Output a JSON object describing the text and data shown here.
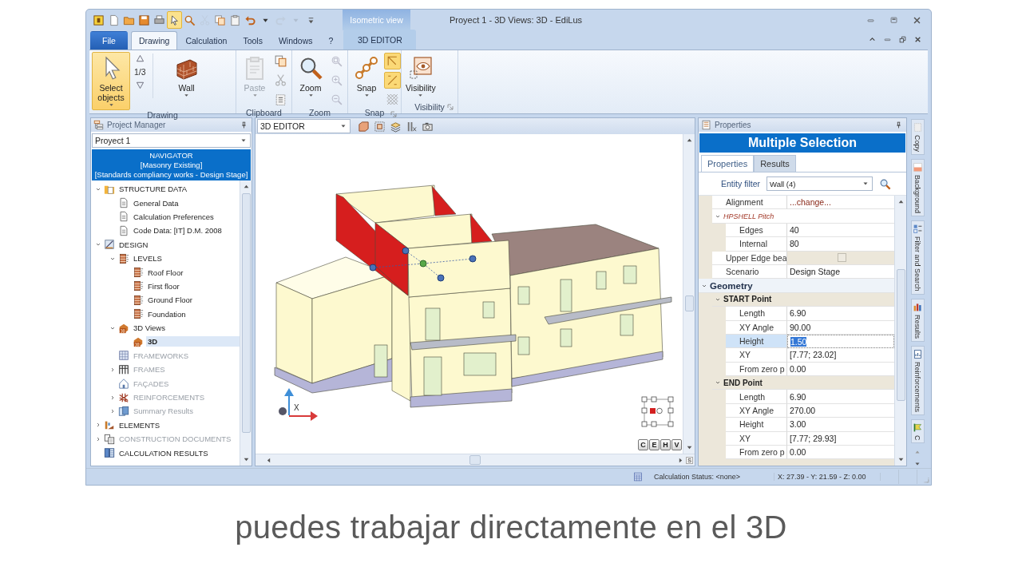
{
  "window": {
    "title": "Proyect 1 - 3D Views: 3D - EdiLus",
    "context_label": "Isometric view"
  },
  "quick_access": [
    {
      "kind": "app",
      "selected": false,
      "disabled": false
    },
    {
      "kind": "new",
      "selected": false,
      "disabled": false
    },
    {
      "kind": "open",
      "selected": false,
      "disabled": false
    },
    {
      "kind": "save",
      "selected": false,
      "disabled": false
    },
    {
      "kind": "print",
      "selected": false,
      "disabled": false
    },
    {
      "kind": "pointer",
      "selected": true,
      "disabled": false
    },
    {
      "kind": "find",
      "selected": false,
      "disabled": false
    },
    {
      "kind": "cut",
      "selected": false,
      "disabled": true
    },
    {
      "kind": "copy",
      "selected": false,
      "disabled": false
    },
    {
      "kind": "paste",
      "selected": false,
      "disabled": false
    },
    {
      "kind": "undo",
      "selected": false,
      "disabled": false
    },
    {
      "kind": "caret",
      "selected": false,
      "disabled": false
    },
    {
      "kind": "redo",
      "selected": false,
      "disabled": true
    },
    {
      "kind": "caret",
      "selected": false,
      "disabled": true
    },
    {
      "kind": "customize",
      "selected": false,
      "disabled": false
    }
  ],
  "tabs": [
    {
      "label": "File",
      "kind": "file",
      "selected": false
    },
    {
      "label": "Drawing",
      "kind": "normal",
      "selected": true
    },
    {
      "label": "Calculation",
      "kind": "normal",
      "selected": false
    },
    {
      "label": "Tools",
      "kind": "normal",
      "selected": false
    },
    {
      "label": "Windows",
      "kind": "normal",
      "selected": false
    },
    {
      "label": "?",
      "kind": "normal",
      "selected": false
    },
    {
      "label": "3D EDITOR",
      "kind": "contextual",
      "selected": false
    }
  ],
  "ribbon": [
    {
      "label": "Drawing",
      "controls": [
        {
          "kind": "select",
          "label": "Select objects",
          "selected": true,
          "disabled": false
        },
        {
          "kind": "gallery",
          "label": "1/3"
        },
        {
          "kind": "wall",
          "label": "Wall",
          "selected": false,
          "disabled": false
        }
      ]
    },
    {
      "label": "Clipboard",
      "controls": [
        {
          "kind": "paste",
          "label": "Paste",
          "selected": false,
          "disabled": true
        },
        {
          "kind": "stack",
          "buttons": [
            {
              "kind": "copy",
              "selected": false,
              "disabled": false
            },
            {
              "kind": "cut",
              "selected": false,
              "disabled": true
            },
            {
              "kind": "paste-special",
              "selected": false,
              "disabled": false
            }
          ]
        }
      ]
    },
    {
      "label": "Zoom",
      "controls": [
        {
          "kind": "zoom",
          "label": "Zoom",
          "selected": false,
          "disabled": false
        },
        {
          "kind": "stack",
          "buttons": [
            {
              "kind": "zoom-window",
              "selected": false,
              "disabled": true
            },
            {
              "kind": "zoom-in",
              "selected": false,
              "disabled": true
            },
            {
              "kind": "zoom-out",
              "selected": false,
              "disabled": true
            }
          ]
        }
      ]
    },
    {
      "label": "Snap",
      "launcher": true,
      "controls": [
        {
          "kind": "snap",
          "label": "Snap",
          "selected": false,
          "disabled": false
        },
        {
          "kind": "stack",
          "buttons": [
            {
              "kind": "snap-corner",
              "selected": true,
              "disabled": false
            },
            {
              "kind": "snap-line",
              "selected": true,
              "disabled": false
            },
            {
              "kind": "snap-grid",
              "selected": false,
              "disabled": false
            }
          ]
        }
      ]
    },
    {
      "label": "Visibility",
      "launcher": true,
      "controls": [
        {
          "kind": "visibility",
          "label": "Visibility",
          "selected": false,
          "disabled": false
        }
      ]
    }
  ],
  "project_manager": {
    "title": "Project Manager",
    "project": "Proyect 1",
    "navigator": [
      "NAVIGATOR",
      "[Masonry Existing]",
      "[Standards compliancy works - Design Stage]"
    ],
    "tree": [
      {
        "label": "STRUCTURE DATA",
        "kind": "folder",
        "expanded": true,
        "disabled": false,
        "selected": false,
        "children": [
          {
            "label": "General Data",
            "kind": "doc",
            "disabled": false,
            "selected": false
          },
          {
            "label": "Calculation Preferences",
            "kind": "doc",
            "disabled": false,
            "selected": false
          },
          {
            "label": "Code Data: [IT] D.M. 2008",
            "kind": "doc",
            "disabled": false,
            "selected": false
          }
        ]
      },
      {
        "label": "DESIGN",
        "kind": "design",
        "expanded": true,
        "disabled": false,
        "selected": false,
        "children": [
          {
            "label": "LEVELS",
            "kind": "level",
            "expanded": true,
            "disabled": false,
            "selected": false,
            "children": [
              {
                "label": "Roof Floor",
                "kind": "level",
                "disabled": false,
                "selected": false
              },
              {
                "label": "First floor",
                "kind": "level",
                "disabled": false,
                "selected": false
              },
              {
                "label": "Ground Floor",
                "kind": "level",
                "disabled": false,
                "selected": false
              },
              {
                "label": "Foundation",
                "kind": "level",
                "disabled": false,
                "selected": false
              }
            ]
          },
          {
            "label": "3D Views",
            "kind": "view3d",
            "expanded": true,
            "disabled": false,
            "selected": false,
            "children": [
              {
                "label": "3D",
                "kind": "view3d",
                "disabled": false,
                "selected": true
              }
            ]
          },
          {
            "label": "FRAMEWORKS",
            "kind": "framework",
            "disabled": true,
            "selected": false
          },
          {
            "label": "FRAMES",
            "kind": "frames",
            "expanded": false,
            "disabled": true,
            "selected": false
          },
          {
            "label": "FAÇADES",
            "kind": "facade",
            "disabled": true,
            "selected": false
          },
          {
            "label": "REINFORCEMENTS",
            "kind": "reinforce",
            "expanded": false,
            "disabled": true,
            "selected": false
          },
          {
            "label": "Summary Results",
            "kind": "summary",
            "expanded": false,
            "disabled": true,
            "selected": false
          }
        ]
      },
      {
        "label": "ELEMENTS",
        "kind": "elements",
        "expanded": false,
        "disabled": false,
        "selected": false
      },
      {
        "label": "CONSTRUCTION DOCUMENTS",
        "kind": "documents",
        "expanded": false,
        "disabled": true,
        "selected": false
      },
      {
        "label": "CALCULATION RESULTS",
        "kind": "results",
        "disabled": false,
        "selected": false
      }
    ]
  },
  "editor": {
    "view": "3D EDITOR",
    "axis_label": "X",
    "view_buttons": [
      "C",
      "E",
      "H",
      "V"
    ],
    "scroll_button": "S"
  },
  "properties": {
    "title": "Properties",
    "header": "Multiple Selection",
    "tabs": [
      {
        "label": "Properties",
        "selected": true
      },
      {
        "label": "Results",
        "selected": false
      }
    ],
    "entity_filter": {
      "label": "Entity filter",
      "value": "Wall (4)"
    },
    "grid": [
      {
        "kind": "action",
        "label": "Alignment",
        "value": "...change...",
        "selected": false
      },
      {
        "kind": "category",
        "label": "HPSHELL Pitch",
        "expanded": true,
        "children": [
          {
            "kind": "property",
            "label": "Edges",
            "value": "40",
            "selected": false
          },
          {
            "kind": "property",
            "label": "Internal",
            "value": "80",
            "selected": false
          }
        ]
      },
      {
        "kind": "checkbox",
        "label": "Upper Edge bea",
        "checked": false,
        "selected": false
      },
      {
        "kind": "property",
        "label": "Scenario",
        "value": "Design Stage",
        "selected": false
      },
      {
        "kind": "section",
        "label": "Geometry",
        "expanded": true,
        "children": [
          {
            "kind": "group",
            "label": "START Point",
            "expanded": true,
            "children": [
              {
                "kind": "property",
                "label": "Length",
                "value": "6.90",
                "selected": false
              },
              {
                "kind": "property",
                "label": "XY Angle",
                "value": "90.00",
                "selected": false
              },
              {
                "kind": "property",
                "label": "Height",
                "value": "1.50",
                "selected": true
              },
              {
                "kind": "property",
                "label": "XY",
                "value": "[7.77; 23.02]",
                "selected": false
              },
              {
                "kind": "property",
                "label": "From zero p",
                "value": "0.00",
                "selected": false
              }
            ]
          },
          {
            "kind": "group",
            "label": "END Point",
            "expanded": true,
            "children": [
              {
                "kind": "property",
                "label": "Length",
                "value": "6.90",
                "selected": false
              },
              {
                "kind": "property",
                "label": "XY Angle",
                "value": "270.00",
                "selected": false
              },
              {
                "kind": "property",
                "label": "Height",
                "value": "3.00",
                "selected": false
              },
              {
                "kind": "property",
                "label": "XY",
                "value": "[7.77; 29.93]",
                "selected": false
              },
              {
                "kind": "property",
                "label": "From zero p",
                "value": "0.00",
                "selected": false
              }
            ]
          }
        ]
      }
    ]
  },
  "side_tabs": [
    {
      "label": "Copy",
      "kind": "copy"
    },
    {
      "label": "Background",
      "kind": "background"
    },
    {
      "label": "Filter and Search",
      "kind": "filter"
    },
    {
      "label": "Results",
      "kind": "results"
    },
    {
      "label": "Reinforcements",
      "kind": "reinforce"
    },
    {
      "label": "C",
      "kind": "check"
    }
  ],
  "status_bar": {
    "calculation": "Calculation Status: <none>",
    "coordinates": "X: 27.39 - Y: 21.59 - Z: 0.00"
  },
  "subtitle": "puedes trabajar directamente en el 3D"
}
